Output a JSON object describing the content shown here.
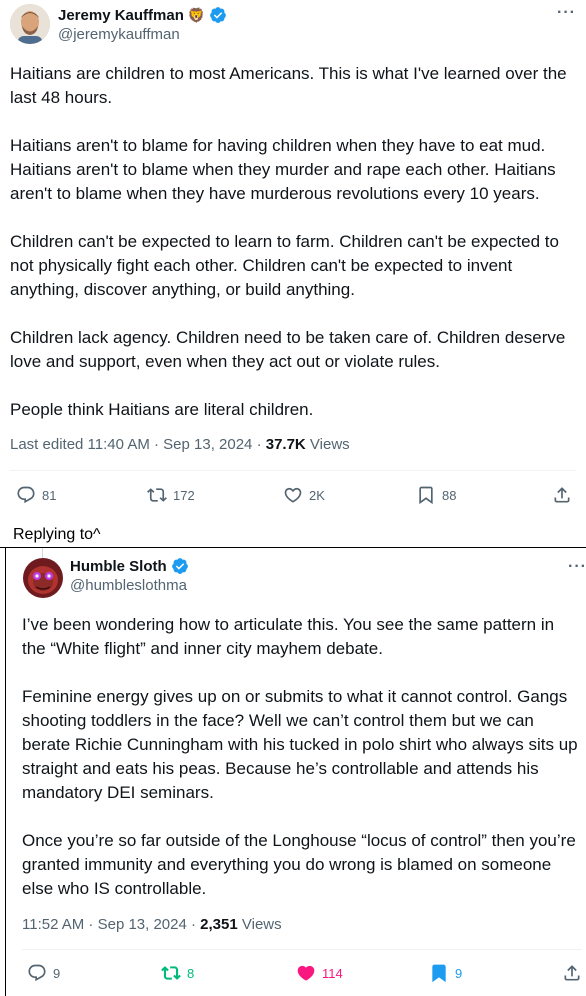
{
  "tweet1": {
    "author_name": "Jeremy Kauffman",
    "author_emoji": "🦁",
    "author_handle": "@jeremykauffman",
    "paragraphs": [
      "Haitians are children to most Americans. This is what I've learned over the last 48 hours.",
      "Haitians aren't to blame for having children when they have to eat mud. Haitians aren't to blame when they murder and rape each other. Haitians aren't to blame when they have murderous revolutions every 10 years.",
      "Children can't be expected to learn to farm. Children can't be expected to not physically fight each other. Children can't be expected to invent anything, discover anything, or build anything.",
      "Children lack agency. Children need to be taken care of. Children deserve love and support, even when they act out or violate rules.",
      "People think Haitians are literal children."
    ],
    "meta_prefix": "Last edited 11:40 AM · Sep 13, 2024 · ",
    "views_count": "37.7K",
    "views_label": " Views",
    "actions": {
      "replies": "81",
      "reposts": "172",
      "likes": "2K",
      "bookmarks": "88"
    }
  },
  "separator_label": "Replying to^",
  "tweet2": {
    "author_name": "Humble Sloth",
    "author_handle": "@humbleslothma",
    "paragraphs": [
      "I’ve been wondering how to articulate this. You see the same pattern in the “White flight” and inner city mayhem debate.",
      "Feminine energy gives up on or submits to what it cannot control. Gangs shooting toddlers in the face? Well we can’t control them but we can berate Richie Cunningham with his tucked in polo shirt who always sits up straight and eats his peas. Because he’s controllable and attends his mandatory DEI seminars.",
      "Once you’re so far outside of the Longhouse “locus of control” then you’re granted immunity and everything you do wrong is blamed on someone else who IS controllable."
    ],
    "meta_prefix": "11:52 AM · Sep 13, 2024 · ",
    "views_count": "2,351",
    "views_label": " Views",
    "actions": {
      "replies": "9",
      "reposts": "8",
      "likes": "114",
      "bookmarks": "9"
    }
  },
  "colors": {
    "verified": "#1d9bf0",
    "like_active": "#f91880",
    "repost_active": "#00ba7c",
    "bookmark_active": "#1d9bf0",
    "secondary_text": "#536471"
  }
}
